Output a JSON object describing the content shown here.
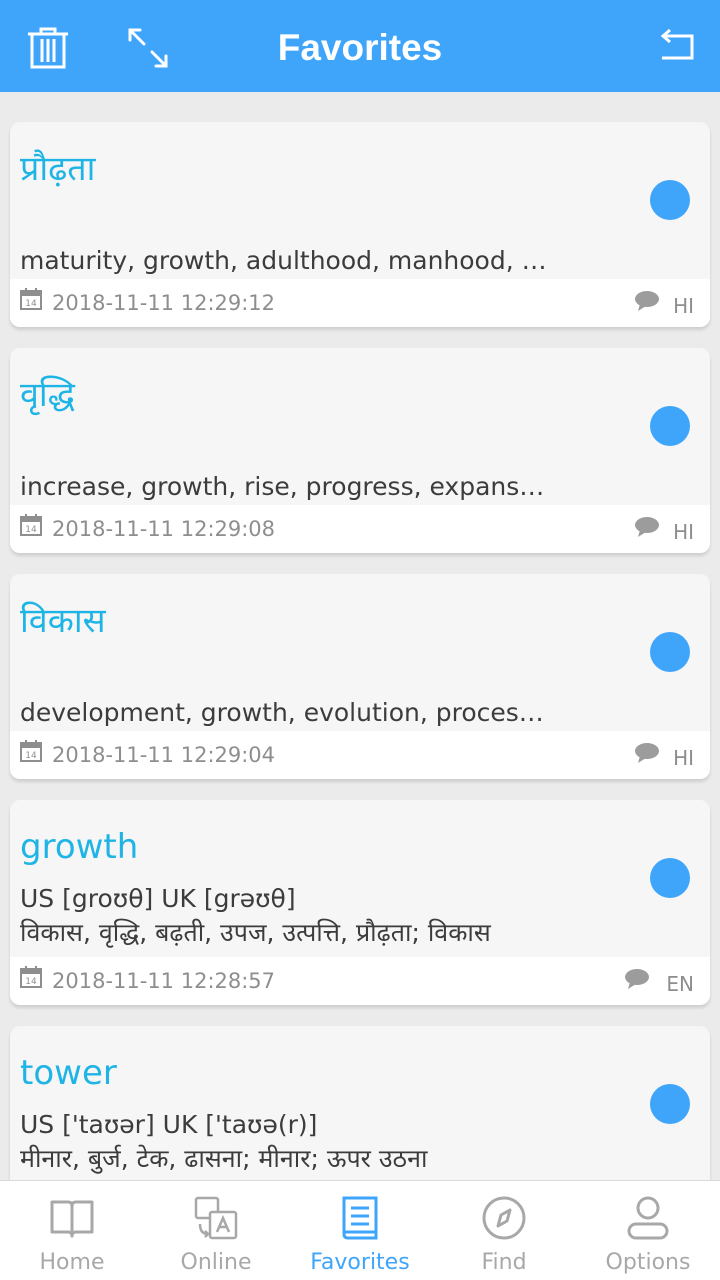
{
  "header": {
    "title": "Favorites",
    "bg": "#3fa5fb"
  },
  "favorites": [
    {
      "word": "प्रौढ़ता",
      "meaning": "maturity, growth, adulthood, manhood, m...",
      "date": "2018-11-11 12:29:12",
      "lang": "HI"
    },
    {
      "word": "वृद्धि",
      "meaning": "increase, growth, rise, progress, expansio...",
      "date": "2018-11-11 12:29:08",
      "lang": "HI"
    },
    {
      "word": "विकास",
      "meaning": "development, growth, evolution, process,...",
      "date": "2018-11-11 12:29:04",
      "lang": "HI"
    },
    {
      "word": "growth",
      "phonetic": "US [groʊθ] UK [grəʊθ]",
      "meaning": "विकास, वृद्धि, बढ़ती, उपज, उत्पत्ति, प्रौढ़ता;  विकास",
      "date": "2018-11-11 12:28:57",
      "lang": "EN"
    },
    {
      "word": "tower",
      "phonetic": "US ['taʊər] UK ['taʊə(r)]",
      "meaning": "मीनार, बुर्ज, टेक, ढासना;  मीनार;  ऊपर उठना"
    }
  ],
  "tabs": [
    {
      "label": "Home",
      "icon": "book-icon"
    },
    {
      "label": "Online",
      "icon": "translate-icon"
    },
    {
      "label": "Favorites",
      "icon": "favorites-icon",
      "active": true
    },
    {
      "label": "Find",
      "icon": "compass-icon"
    },
    {
      "label": "Options",
      "icon": "user-icon"
    }
  ],
  "colors": {
    "accent": "#3fa5fb",
    "word": "#1fb4e6",
    "text": "#3c3c3c",
    "muted": "#8e8e8e",
    "tab_inactive": "#a8a8a8"
  }
}
